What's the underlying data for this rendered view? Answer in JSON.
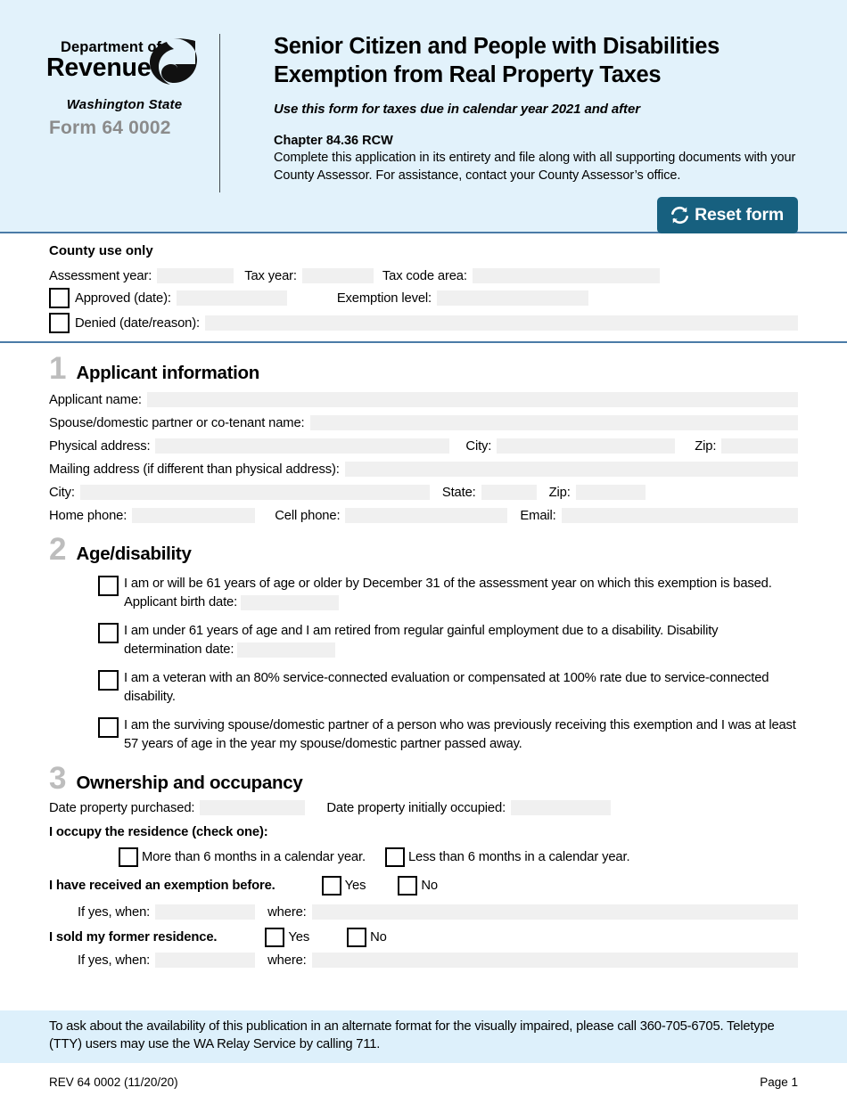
{
  "header": {
    "logo": {
      "department_line": "Department of",
      "revenue_line": "Revenue",
      "state_line": "Washington State"
    },
    "form_number": "Form 64 0002",
    "title": "Senior Citizen and People with Disabilities Exemption from Real Property Taxes",
    "subtitle": "Use this form for taxes due in calendar year 2021 and after",
    "chapter": "Chapter 84.36 RCW",
    "instructions": "Complete this application in its entirety and file along with all supporting documents with your County Assessor. For assistance, contact your County Assessor’s office.",
    "reset_button": "Reset form",
    "accent_color": "#17607f",
    "background_color": "#e2f2fb",
    "rule_color": "#4a7ba7"
  },
  "county_use": {
    "title": "County use only",
    "assessment_year_label": "Assessment year:",
    "assessment_year_value": "",
    "tax_year_label": "Tax year:",
    "tax_year_value": "",
    "tax_code_area_label": "Tax code area:",
    "tax_code_area_value": "",
    "approved_label": "Approved (date):",
    "approved_value": "",
    "approved_checked": false,
    "exemption_level_label": "Exemption level:",
    "exemption_level_value": "",
    "denied_label": "Denied (date/reason):",
    "denied_value": "",
    "denied_checked": false
  },
  "section1": {
    "number": "1",
    "title": "Applicant information",
    "applicant_name_label": "Applicant name:",
    "applicant_name_value": "",
    "spouse_label": "Spouse/domestic partner or co-tenant name:",
    "spouse_value": "",
    "physical_address_label": "Physical address:",
    "physical_address_value": "",
    "physical_city_label": "City:",
    "physical_city_value": "",
    "physical_zip_label": "Zip:",
    "physical_zip_value": "",
    "mailing_address_label": "Mailing address (if different than physical address):",
    "mailing_address_value": "",
    "mailing_city_label": "City:",
    "mailing_city_value": "",
    "mailing_state_label": "State:",
    "mailing_state_value": "",
    "mailing_zip_label": "Zip:",
    "mailing_zip_value": "",
    "home_phone_label": "Home phone:",
    "home_phone_value": "",
    "cell_phone_label": "Cell phone:",
    "cell_phone_value": "",
    "email_label": "Email:",
    "email_value": ""
  },
  "section2": {
    "number": "2",
    "title": "Age/disability",
    "options": [
      {
        "text": "I am or will be 61 years of age or older by December 31 of the assessment year on which this exemption is based.  Applicant birth date:",
        "checked": false,
        "has_field": true,
        "field_value": ""
      },
      {
        "text": "I am under 61 years of age and I am retired from regular gainful employment due to a disability. Disability determination date:",
        "checked": false,
        "has_field": true,
        "field_value": ""
      },
      {
        "text": "I am a veteran with an 80% service-connected evaluation or compensated at 100% rate due to service-connected disability.",
        "checked": false,
        "has_field": false,
        "field_value": ""
      },
      {
        "text": "I am the surviving spouse/domestic partner of a person who was previously receiving this exemption and I was at least 57 years of age in the year my spouse/domestic partner passed away.",
        "checked": false,
        "has_field": false,
        "field_value": ""
      }
    ]
  },
  "section3": {
    "number": "3",
    "title": "Ownership and occupancy",
    "date_purchased_label": "Date property purchased:",
    "date_purchased_value": "",
    "date_occupied_label": "Date property initially occupied:",
    "date_occupied_value": "",
    "occupy_prompt": "I occupy the residence (check one):",
    "occupy_more_label": "More than 6 months in a calendar year.",
    "occupy_more_checked": false,
    "occupy_less_label": "Less than 6 months in a calendar year.",
    "occupy_less_checked": false,
    "exemption_before_label": "I have received an exemption before.",
    "exemption_before_yes": "Yes",
    "exemption_before_yes_checked": false,
    "exemption_before_no": "No",
    "exemption_before_no_checked": false,
    "exemption_when_label": "If yes, when:",
    "exemption_when_value": "",
    "exemption_where_label": "where:",
    "exemption_where_value": "",
    "sold_residence_label": "I sold my former residence.",
    "sold_yes": "Yes",
    "sold_yes_checked": false,
    "sold_no": "No",
    "sold_no_checked": false,
    "sold_when_label": "If yes, when:",
    "sold_when_value": "",
    "sold_where_label": "where:",
    "sold_where_value": ""
  },
  "footer": {
    "accessibility_note": "To ask about the availability of this publication in an alternate format for the visually impaired, please call 360-705-6705. Teletype (TTY) users may use the WA Relay Service by calling 711.",
    "revision": "REV 64 0002 (11/20/20)",
    "page": "Page 1",
    "background_color": "#ddf0fb"
  }
}
